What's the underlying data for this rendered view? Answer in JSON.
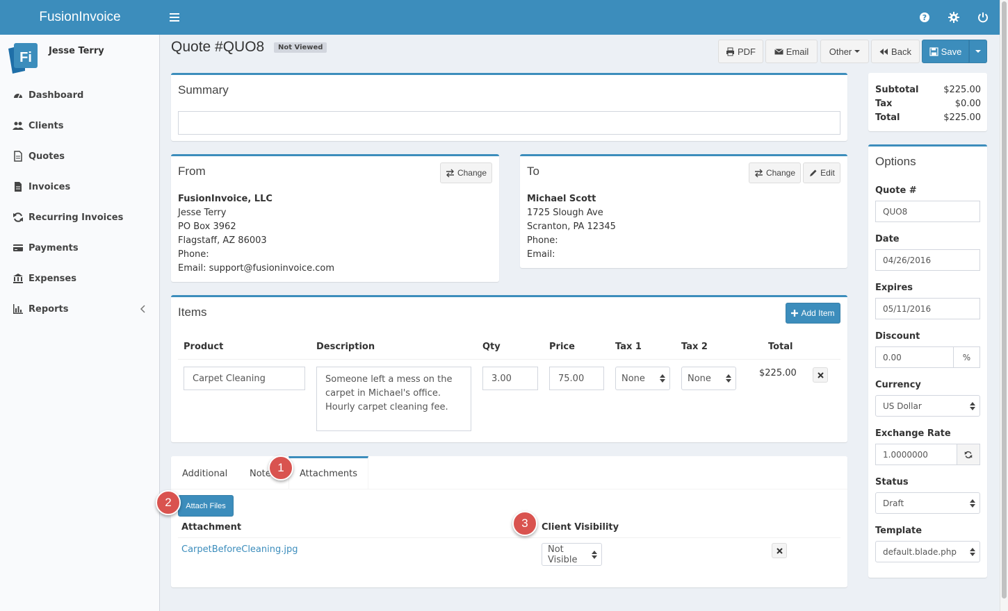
{
  "app": {
    "brand": "FusionInvoice",
    "user_name": "Jesse Terry"
  },
  "sidebar": {
    "items": [
      {
        "label": "Dashboard",
        "icon": "dashboard-icon"
      },
      {
        "label": "Clients",
        "icon": "users-icon"
      },
      {
        "label": "Quotes",
        "icon": "file-icon"
      },
      {
        "label": "Invoices",
        "icon": "file-text-icon"
      },
      {
        "label": "Recurring Invoices",
        "icon": "refresh-icon"
      },
      {
        "label": "Payments",
        "icon": "credit-card-icon"
      },
      {
        "label": "Expenses",
        "icon": "bank-icon"
      },
      {
        "label": "Reports",
        "icon": "bar-chart-icon"
      }
    ]
  },
  "header": {
    "title": "Quote #QUO8",
    "status_badge": "Not Viewed",
    "buttons": {
      "pdf": "PDF",
      "email": "Email",
      "other": "Other",
      "back": "Back",
      "save": "Save"
    }
  },
  "summary": {
    "title": "Summary",
    "value": ""
  },
  "from": {
    "title": "From",
    "change_label": "Change",
    "company": "FusionInvoice, LLC",
    "lines": [
      "Jesse Terry",
      "PO Box 3962",
      "Flagstaff, AZ 86003",
      "Phone:",
      "Email: support@fusioninvoice.com"
    ]
  },
  "to": {
    "title": "To",
    "change_label": "Change",
    "edit_label": "Edit",
    "name": "Michael Scott",
    "lines": [
      "1725 Slough Ave",
      "Scranton, PA 12345",
      "Phone:",
      "Email:"
    ]
  },
  "items": {
    "title": "Items",
    "add_label": "Add Item",
    "columns": {
      "product": "Product",
      "description": "Description",
      "qty": "Qty",
      "price": "Price",
      "tax1": "Tax 1",
      "tax2": "Tax 2",
      "total": "Total"
    },
    "rows": [
      {
        "product": "Carpet Cleaning",
        "description": "Someone left a mess on the carpet in Michael's office. Hourly carpet cleaning fee.",
        "qty": "3.00",
        "price": "75.00",
        "tax1": "None",
        "tax2": "None",
        "total": "$225.00"
      }
    ]
  },
  "tabs": {
    "additional": "Additional",
    "notes": "Notes",
    "attachments": "Attachments",
    "attach_files": "Attach Files",
    "col_attachment": "Attachment",
    "col_visibility": "Client Visibility",
    "file_name": "CarpetBeforeCleaning.jpg",
    "visibility": "Not Visible"
  },
  "markers": [
    "1",
    "2",
    "3"
  ],
  "totals": {
    "subtotal_label": "Subtotal",
    "subtotal": "$225.00",
    "tax_label": "Tax",
    "tax": "$0.00",
    "total_label": "Total",
    "total": "$225.00"
  },
  "options": {
    "title": "Options",
    "quote_label": "Quote #",
    "quote": "QUO8",
    "date_label": "Date",
    "date": "04/26/2016",
    "expires_label": "Expires",
    "expires": "05/11/2016",
    "discount_label": "Discount",
    "discount": "0.00",
    "discount_unit": "%",
    "currency_label": "Currency",
    "currency": "US Dollar",
    "rate_label": "Exchange Rate",
    "rate": "1.0000000",
    "status_label": "Status",
    "status": "Draft",
    "template_label": "Template",
    "template": "default.blade.php"
  },
  "colors": {
    "primary": "#3c8dbc",
    "marker": "#d9534f",
    "sidebar_bg": "#f9fafc",
    "content_bg": "#ecf0f5"
  }
}
